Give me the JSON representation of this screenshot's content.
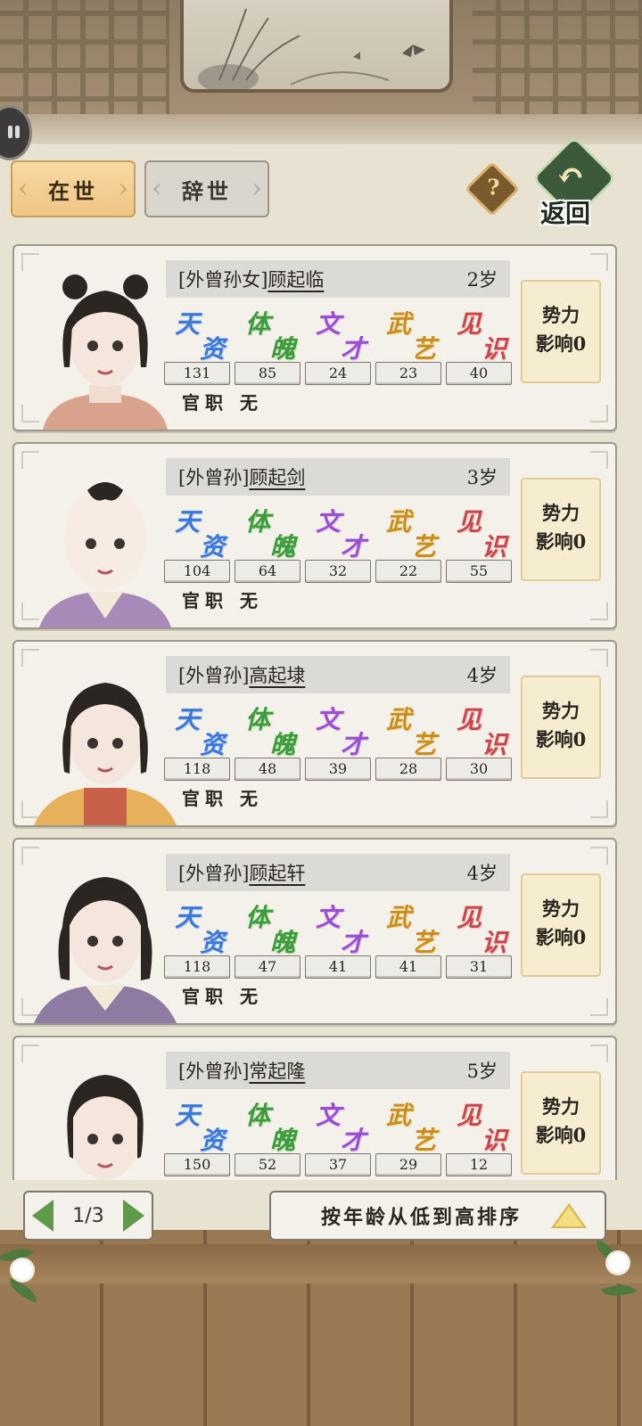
{
  "tabs": {
    "alive": "在世",
    "deceased": "辞世"
  },
  "help": {
    "glyph": "?"
  },
  "back": {
    "label": "返回",
    "arrow": "↶"
  },
  "stat_labels": {
    "talent": [
      "天",
      "资"
    ],
    "physique": [
      "体",
      "魄"
    ],
    "literacy": [
      "文",
      "才"
    ],
    "martial": [
      "武",
      "艺"
    ],
    "insight": [
      "见",
      "识"
    ]
  },
  "stat_colors": {
    "talent": "#3b78d8",
    "physique": "#3d9a3d",
    "literacy": "#9b4fd0",
    "martial": "#c98e1e",
    "insight": "#c9474a"
  },
  "influence_label": [
    "势力",
    "影响0"
  ],
  "members": [
    {
      "relation": "[外曾孙女]",
      "name": "顾起临",
      "age": "2岁",
      "stats": [
        "131",
        "85",
        "24",
        "23",
        "40"
      ],
      "office": "官职 无"
    },
    {
      "relation": "[外曾孙]",
      "name": "顾起剑",
      "age": "3岁",
      "stats": [
        "104",
        "64",
        "32",
        "22",
        "55"
      ],
      "office": "官职 无"
    },
    {
      "relation": "[外曾孙]",
      "name": "高起埭",
      "age": "4岁",
      "stats": [
        "118",
        "48",
        "39",
        "28",
        "30"
      ],
      "office": "官职 无"
    },
    {
      "relation": "[外曾孙]",
      "name": "顾起轩",
      "age": "4岁",
      "stats": [
        "118",
        "47",
        "41",
        "41",
        "31"
      ],
      "office": "官职 无"
    },
    {
      "relation": "[外曾孙]",
      "name": "常起隆",
      "age": "5岁",
      "stats": [
        "150",
        "52",
        "37",
        "29",
        "12"
      ],
      "office": ""
    }
  ],
  "pager": {
    "text": "1/3"
  },
  "sort": {
    "label": "按年龄从低到高排序"
  }
}
